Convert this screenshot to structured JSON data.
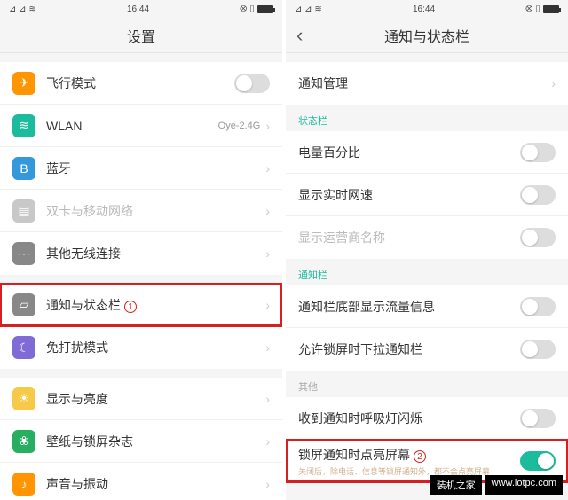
{
  "statusbar": {
    "time": "16:44"
  },
  "left": {
    "title": "设置",
    "rows": [
      {
        "id": "airplane",
        "icon": "✈",
        "cls": "ic-orange",
        "label": "飞行模式",
        "ctrl": "toggle",
        "on": false
      },
      {
        "id": "wlan",
        "icon": "≋",
        "cls": "ic-teal",
        "label": "WLAN",
        "ctrl": "value",
        "value": "Oye-2.4G"
      },
      {
        "id": "bt",
        "icon": "B",
        "cls": "ic-blue",
        "label": "蓝牙",
        "ctrl": "chev"
      },
      {
        "id": "sim",
        "icon": "▤",
        "cls": "ic-gray",
        "label": "双卡与移动网络",
        "ctrl": "chev",
        "disabled": true
      },
      {
        "id": "wireless",
        "icon": "⋯",
        "cls": "ic-dark",
        "label": "其他无线连接",
        "ctrl": "chev"
      }
    ],
    "rows2": [
      {
        "id": "notif",
        "icon": "▱",
        "cls": "ic-dark",
        "label": "通知与状态栏",
        "ctrl": "chev",
        "hl": true,
        "num": "1"
      },
      {
        "id": "dnd",
        "icon": "☾",
        "cls": "ic-purple",
        "label": "免打扰模式",
        "ctrl": "chev"
      }
    ],
    "rows3": [
      {
        "id": "display",
        "icon": "☀",
        "cls": "ic-yellow",
        "label": "显示与亮度",
        "ctrl": "chev"
      },
      {
        "id": "wallpaper",
        "icon": "❀",
        "cls": "ic-green",
        "label": "壁纸与锁屏杂志",
        "ctrl": "chev"
      },
      {
        "id": "sound",
        "icon": "♪",
        "cls": "ic-orange",
        "label": "声音与振动",
        "ctrl": "chev"
      }
    ]
  },
  "right": {
    "title": "通知与状态栏",
    "rows1": [
      {
        "id": "mgr",
        "label": "通知管理",
        "ctrl": "chev"
      }
    ],
    "grp2": "状态栏",
    "rows2": [
      {
        "id": "batt",
        "label": "电量百分比",
        "ctrl": "toggle",
        "on": false
      },
      {
        "id": "speed",
        "label": "显示实时网速",
        "ctrl": "toggle",
        "on": false
      },
      {
        "id": "carrier",
        "label": "显示运营商名称",
        "ctrl": "toggle",
        "on": false,
        "disabled": true
      }
    ],
    "grp3": "通知栏",
    "rows3": [
      {
        "id": "traffic",
        "label": "通知栏底部显示流量信息",
        "ctrl": "toggle",
        "on": false
      },
      {
        "id": "lockpull",
        "label": "允许锁屏时下拉通知栏",
        "ctrl": "toggle",
        "on": false
      }
    ],
    "grp4": "其他",
    "rows4": [
      {
        "id": "led",
        "label": "收到通知时呼吸灯闪烁",
        "ctrl": "toggle",
        "on": false
      },
      {
        "id": "wake",
        "label": "锁屏通知时点亮屏幕",
        "sub": "关闭后，除电话、信息等锁屏通知外，都不会点亮屏幕",
        "ctrl": "toggle",
        "on": true,
        "hl": true,
        "num": "2"
      }
    ]
  },
  "watermark": {
    "a": "装机之家",
    "b": "www.lotpc.com"
  }
}
